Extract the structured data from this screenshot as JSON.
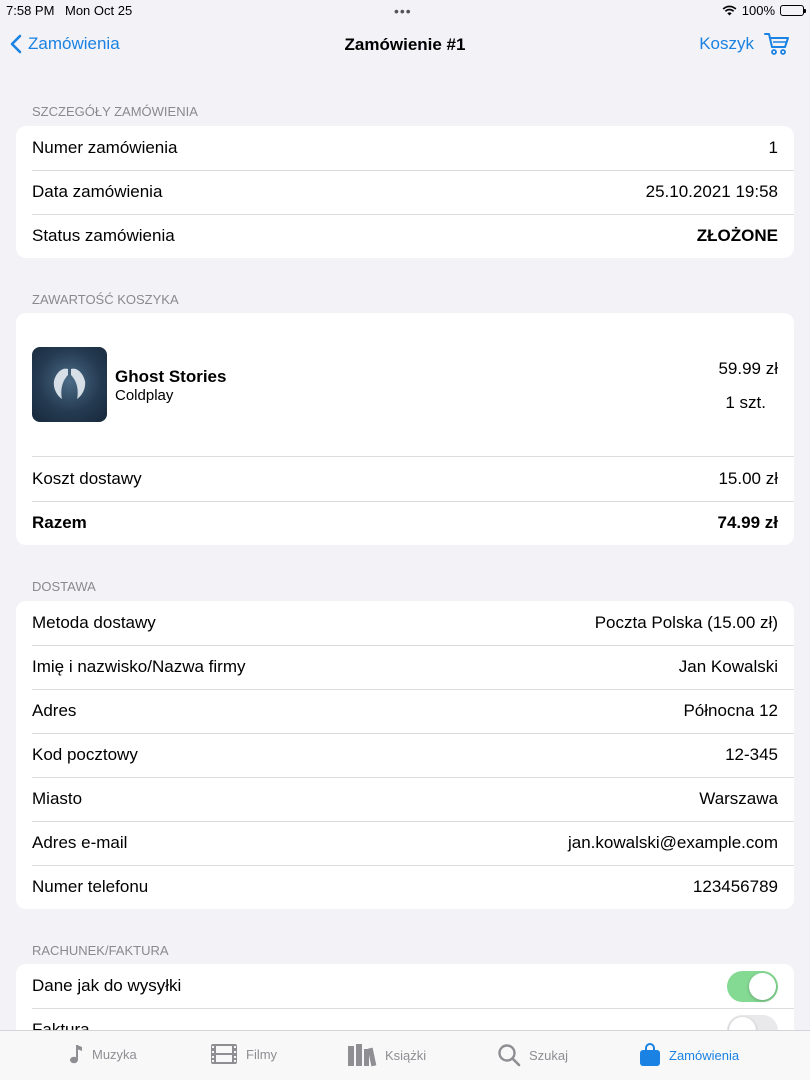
{
  "status_bar": {
    "time": "7:58 PM",
    "date": "Mon Oct 25",
    "battery": "100%"
  },
  "nav": {
    "back_label": "Zamówienia",
    "title": "Zamówienie #1",
    "cart_label": "Koszyk"
  },
  "sections": {
    "details": {
      "header": "SZCZEGÓŁY ZAMÓWIENIA",
      "rows": [
        {
          "label": "Numer zamówienia",
          "value": "1"
        },
        {
          "label": "Data zamówienia",
          "value": "25.10.2021 19:58"
        },
        {
          "label": "Status zamówienia",
          "value": "ZŁOŻONE"
        }
      ]
    },
    "cart": {
      "header": "ZAWARTOŚĆ KOSZYKA",
      "item": {
        "title": "Ghost Stories",
        "artist": "Coldplay",
        "price": "59.99 zł",
        "quantity": "1 szt."
      },
      "shipping_label": "Koszt dostawy",
      "shipping_value": "15.00 zł",
      "total_label": "Razem",
      "total_value": "74.99 zł"
    },
    "delivery": {
      "header": "DOSTAWA",
      "rows": [
        {
          "label": "Metoda dostawy",
          "value": "Poczta Polska (15.00 zł)"
        },
        {
          "label": "Imię i nazwisko/Nazwa firmy",
          "value": "Jan Kowalski"
        },
        {
          "label": "Adres",
          "value": "Północna 12"
        },
        {
          "label": "Kod pocztowy",
          "value": "12-345"
        },
        {
          "label": "Miasto",
          "value": "Warszawa"
        },
        {
          "label": "Adres e-mail",
          "value": "jan.kowalski@example.com"
        },
        {
          "label": "Numer telefonu",
          "value": "123456789"
        }
      ]
    },
    "invoice": {
      "header": "RACHUNEK/FAKTURA",
      "rows": [
        {
          "label": "Dane jak do wysyłki",
          "toggle_on": true
        },
        {
          "label": "Faktura",
          "toggle_on": false
        }
      ]
    }
  },
  "tabs": [
    {
      "label": "Muzyka",
      "icon": "music-note-icon"
    },
    {
      "label": "Filmy",
      "icon": "film-icon"
    },
    {
      "label": "Książki",
      "icon": "books-icon"
    },
    {
      "label": "Szukaj",
      "icon": "search-icon"
    },
    {
      "label": "Zamówienia",
      "icon": "bag-icon",
      "active": true
    }
  ],
  "colors": {
    "accent": "#1a82e2",
    "toggle_on": "#84d993",
    "background": "#f2f2f7"
  }
}
